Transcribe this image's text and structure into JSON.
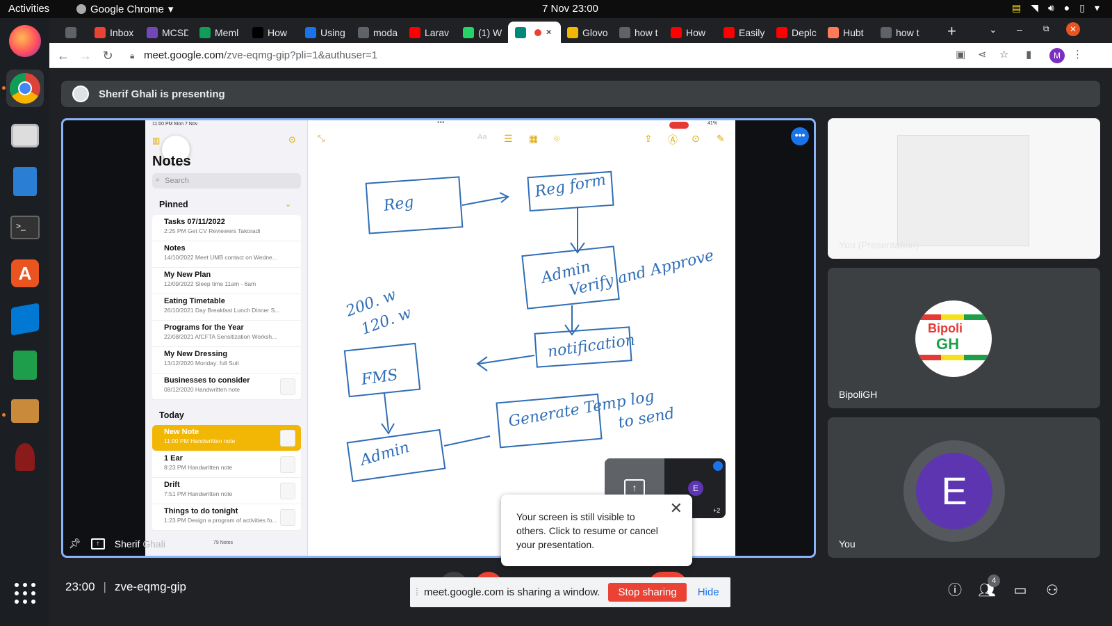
{
  "gnome": {
    "activities": "Activities",
    "app": "Google Chrome",
    "clock": "7 Nov  23:00"
  },
  "tabs": [
    {
      "label": "",
      "color": "#5f6368",
      "icon": "clipboard-icon"
    },
    {
      "label": "Inbox",
      "color": "#ea4335",
      "icon": "gmail-icon"
    },
    {
      "label": "MCSD",
      "color": "#7248b9",
      "icon": "list-icon"
    },
    {
      "label": "Meml",
      "color": "#0f9d58",
      "icon": "plus-icon"
    },
    {
      "label": "How",
      "color": "#000000",
      "icon": "medium-icon"
    },
    {
      "label": "Using",
      "color": "#1a73e8",
      "icon": "s-icon"
    },
    {
      "label": "moda",
      "color": "#5f6368",
      "icon": "google-icon"
    },
    {
      "label": "Larav",
      "color": "#ff0000",
      "icon": "youtube-icon"
    },
    {
      "label": "(1) W",
      "color": "#25d366",
      "icon": "whatsapp-icon"
    },
    {
      "label": "",
      "color": "#00897b",
      "icon": "meet-icon"
    },
    {
      "label": "Glovo",
      "color": "#f2b705",
      "icon": "glovo-icon"
    },
    {
      "label": "how t",
      "color": "#5f6368",
      "icon": "google-icon"
    },
    {
      "label": "How",
      "color": "#ff0000",
      "icon": "youtube-icon"
    },
    {
      "label": "Easily",
      "color": "#ff0000",
      "icon": "youtube-icon"
    },
    {
      "label": "Deplc",
      "color": "#ff0000",
      "icon": "youtube-icon"
    },
    {
      "label": "Hubt",
      "color": "#ff7a59",
      "icon": "hubspot-icon"
    },
    {
      "label": "how t",
      "color": "#5f6368",
      "icon": "google-icon"
    }
  ],
  "omnibox": {
    "host": "meet.google.com",
    "path": "/zve-eqmg-gip?pli=1&authuser=1",
    "profile_initial": "M"
  },
  "meet": {
    "presenting_text": "Sherif Ghali is presenting",
    "presenter_name": "Sherif",
    "presenter_name_dim": "Ghali",
    "meeting_time": "23:00",
    "meeting_code": "zve-eqmg-gip",
    "participants_count": "4",
    "share_banner_text": "meet.google.com is sharing a window.",
    "stop_sharing": "Stop sharing",
    "hide": "Hide",
    "tooltip_text": "Your screen is still visible to others. Click to resume or cancel your presentation.",
    "tiles": [
      {
        "label": "You (Presentation)"
      },
      {
        "label": "BipoliGH",
        "logo_text_1": "Bipoli",
        "logo_text_2": "GH"
      },
      {
        "label": "You",
        "initial": "E"
      }
    ],
    "pip_initial": "E",
    "pip_more": "+2"
  },
  "ipad": {
    "status_time": "11:00 PM  Mon 7 Nov",
    "battery": "41%",
    "notes_title": "Notes",
    "search_placeholder": "Search",
    "pinned_label": "Pinned",
    "today_label": "Today",
    "notes_count": "79 Notes",
    "pinned": [
      {
        "title": "Tasks 07/11/2022",
        "sub": "2:25 PM  Get CV Reviewers Takoradi"
      },
      {
        "title": "Notes",
        "sub": "14/10/2022  Meet UMB contact on Wedne..."
      },
      {
        "title": "My New Plan",
        "sub": "12/09/2022  Sleep time 11am - 6am"
      },
      {
        "title": "Eating Timetable",
        "sub": "26/10/2021  Day Breakfast Lunch Dinner S..."
      },
      {
        "title": "Programs for the Year",
        "sub": "22/08/2021  AfCFTA Sensitization Worksh..."
      },
      {
        "title": "My New Dressing",
        "sub": "13/12/2020  Monday: full Suit"
      },
      {
        "title": "Businesses to consider",
        "sub": "08/12/2020  Handwritten note"
      }
    ],
    "today": [
      {
        "title": "New Note",
        "sub": "11:00 PM  Handwritten note"
      },
      {
        "title": "1 Ear",
        "sub": "8:23 PM  Handwritten note"
      },
      {
        "title": "Drift",
        "sub": "7:51 PM  Handwritten note"
      },
      {
        "title": "Things to do tonight",
        "sub": "1:23 PM  Design a program of activities fo..."
      }
    ],
    "drawing": {
      "words": [
        "Reg",
        "Reg form",
        "Admin",
        "Verify and Approve",
        "notification",
        "FMS",
        "Admin",
        "Generate Temp log",
        "to send",
        "200. w",
        "120. w"
      ]
    }
  }
}
